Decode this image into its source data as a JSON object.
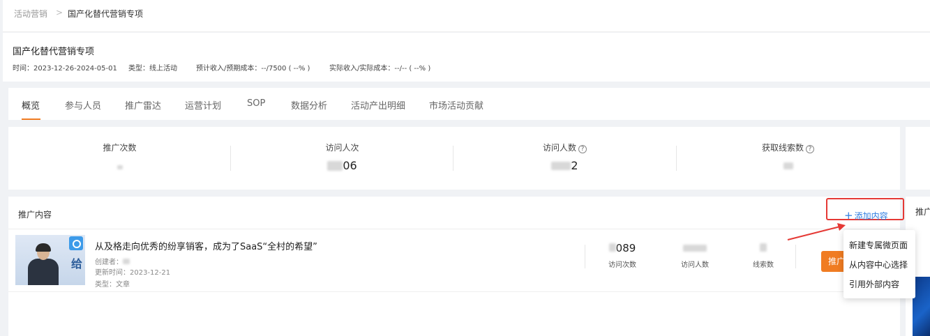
{
  "breadcrumb": {
    "root": "活动营销",
    "separator": ">",
    "current": "国产化替代营销专项"
  },
  "header": {
    "title": "国产化替代营销专项",
    "time": "时间：2023-12-26-2024-05-01",
    "type": "类型：线上活动",
    "expected": "预计收入/预期成本：--/7500 ( --% )",
    "actual": "实际收入/实际成本：--/-- ( --% )"
  },
  "tabs": [
    {
      "label": "概览",
      "active": true
    },
    {
      "label": "参与人员"
    },
    {
      "label": "推广雷达"
    },
    {
      "label": "运营计划"
    },
    {
      "label": "SOP"
    },
    {
      "label": "数据分析"
    },
    {
      "label": "活动产出明细"
    },
    {
      "label": "市场活动贡献"
    }
  ],
  "stats": [
    {
      "label": "推广次数",
      "value": "",
      "help": false
    },
    {
      "label": "访问人次",
      "value": "06",
      "help": false
    },
    {
      "label": "访问人数",
      "value": "2",
      "help": true
    },
    {
      "label": "获取线索数",
      "value": "",
      "help": true
    }
  ],
  "help_icon": "question-circle-icon",
  "content": {
    "title": "推广内容",
    "add_button": "添加内容",
    "add_icon": "plus-icon"
  },
  "right_panel": {
    "title": "推广"
  },
  "item": {
    "title": "从及格走向优秀的纷享销客，成为了SaaS“全村的希望”",
    "creator_label": "创建者：",
    "updated": "更新时间：2023-12-21",
    "type": "类型：文章",
    "thumb_glyph": "给",
    "metrics": [
      {
        "label": "访问次数",
        "value": "089"
      },
      {
        "label": "访问人数",
        "value": ""
      },
      {
        "label": "线索数",
        "value": ""
      }
    ],
    "promo_button": "推广"
  },
  "dropdown": {
    "items": [
      "新建专属微页面",
      "从内容中心选择",
      "引用外部内容"
    ]
  },
  "colors": {
    "accent": "#f07c22",
    "link": "#2f7de1",
    "highlight": "#e53935"
  }
}
